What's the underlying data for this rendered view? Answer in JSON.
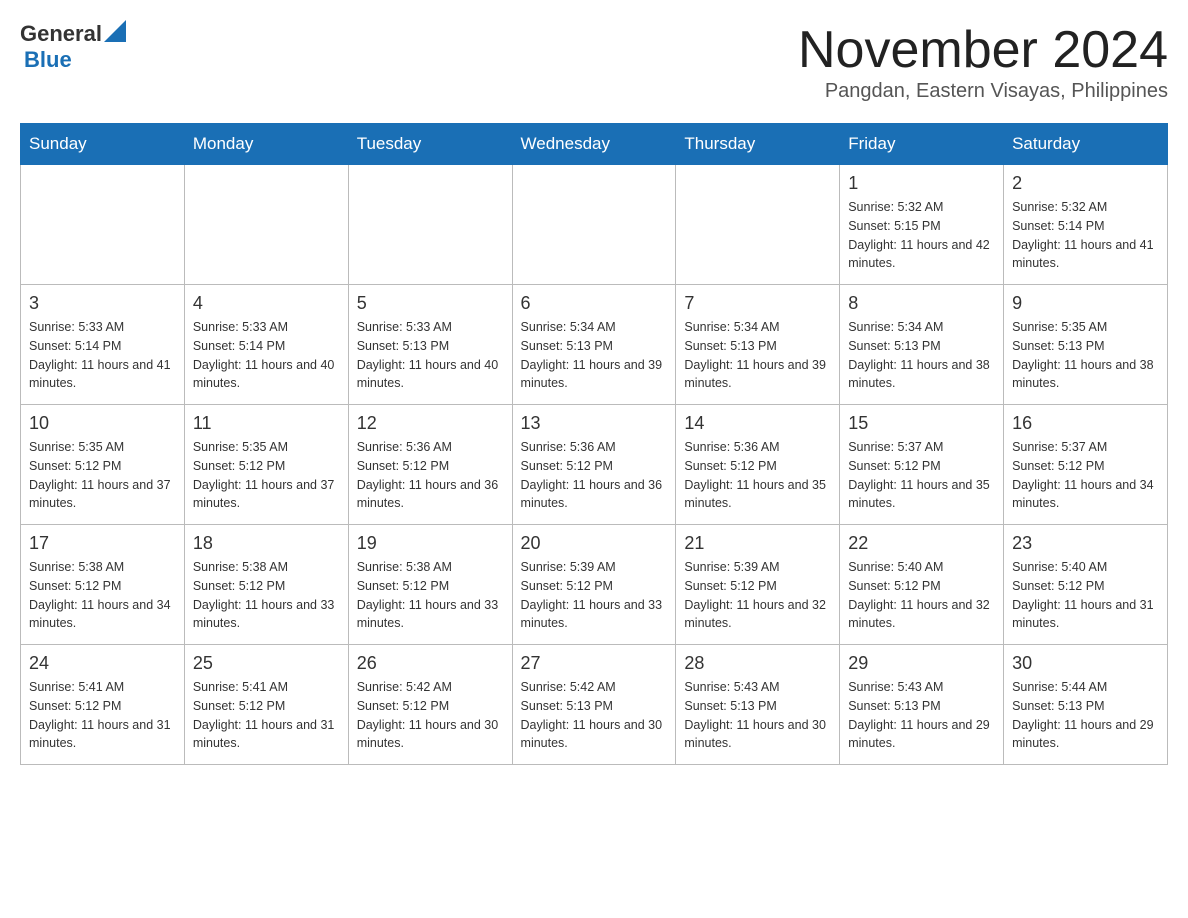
{
  "header": {
    "logo_general": "General",
    "logo_blue": "Blue",
    "month_title": "November 2024",
    "location": "Pangdan, Eastern Visayas, Philippines"
  },
  "weekdays": [
    "Sunday",
    "Monday",
    "Tuesday",
    "Wednesday",
    "Thursday",
    "Friday",
    "Saturday"
  ],
  "weeks": [
    [
      {
        "day": "",
        "info": ""
      },
      {
        "day": "",
        "info": ""
      },
      {
        "day": "",
        "info": ""
      },
      {
        "day": "",
        "info": ""
      },
      {
        "day": "",
        "info": ""
      },
      {
        "day": "1",
        "info": "Sunrise: 5:32 AM\nSunset: 5:15 PM\nDaylight: 11 hours and 42 minutes."
      },
      {
        "day": "2",
        "info": "Sunrise: 5:32 AM\nSunset: 5:14 PM\nDaylight: 11 hours and 41 minutes."
      }
    ],
    [
      {
        "day": "3",
        "info": "Sunrise: 5:33 AM\nSunset: 5:14 PM\nDaylight: 11 hours and 41 minutes."
      },
      {
        "day": "4",
        "info": "Sunrise: 5:33 AM\nSunset: 5:14 PM\nDaylight: 11 hours and 40 minutes."
      },
      {
        "day": "5",
        "info": "Sunrise: 5:33 AM\nSunset: 5:13 PM\nDaylight: 11 hours and 40 minutes."
      },
      {
        "day": "6",
        "info": "Sunrise: 5:34 AM\nSunset: 5:13 PM\nDaylight: 11 hours and 39 minutes."
      },
      {
        "day": "7",
        "info": "Sunrise: 5:34 AM\nSunset: 5:13 PM\nDaylight: 11 hours and 39 minutes."
      },
      {
        "day": "8",
        "info": "Sunrise: 5:34 AM\nSunset: 5:13 PM\nDaylight: 11 hours and 38 minutes."
      },
      {
        "day": "9",
        "info": "Sunrise: 5:35 AM\nSunset: 5:13 PM\nDaylight: 11 hours and 38 minutes."
      }
    ],
    [
      {
        "day": "10",
        "info": "Sunrise: 5:35 AM\nSunset: 5:12 PM\nDaylight: 11 hours and 37 minutes."
      },
      {
        "day": "11",
        "info": "Sunrise: 5:35 AM\nSunset: 5:12 PM\nDaylight: 11 hours and 37 minutes."
      },
      {
        "day": "12",
        "info": "Sunrise: 5:36 AM\nSunset: 5:12 PM\nDaylight: 11 hours and 36 minutes."
      },
      {
        "day": "13",
        "info": "Sunrise: 5:36 AM\nSunset: 5:12 PM\nDaylight: 11 hours and 36 minutes."
      },
      {
        "day": "14",
        "info": "Sunrise: 5:36 AM\nSunset: 5:12 PM\nDaylight: 11 hours and 35 minutes."
      },
      {
        "day": "15",
        "info": "Sunrise: 5:37 AM\nSunset: 5:12 PM\nDaylight: 11 hours and 35 minutes."
      },
      {
        "day": "16",
        "info": "Sunrise: 5:37 AM\nSunset: 5:12 PM\nDaylight: 11 hours and 34 minutes."
      }
    ],
    [
      {
        "day": "17",
        "info": "Sunrise: 5:38 AM\nSunset: 5:12 PM\nDaylight: 11 hours and 34 minutes."
      },
      {
        "day": "18",
        "info": "Sunrise: 5:38 AM\nSunset: 5:12 PM\nDaylight: 11 hours and 33 minutes."
      },
      {
        "day": "19",
        "info": "Sunrise: 5:38 AM\nSunset: 5:12 PM\nDaylight: 11 hours and 33 minutes."
      },
      {
        "day": "20",
        "info": "Sunrise: 5:39 AM\nSunset: 5:12 PM\nDaylight: 11 hours and 33 minutes."
      },
      {
        "day": "21",
        "info": "Sunrise: 5:39 AM\nSunset: 5:12 PM\nDaylight: 11 hours and 32 minutes."
      },
      {
        "day": "22",
        "info": "Sunrise: 5:40 AM\nSunset: 5:12 PM\nDaylight: 11 hours and 32 minutes."
      },
      {
        "day": "23",
        "info": "Sunrise: 5:40 AM\nSunset: 5:12 PM\nDaylight: 11 hours and 31 minutes."
      }
    ],
    [
      {
        "day": "24",
        "info": "Sunrise: 5:41 AM\nSunset: 5:12 PM\nDaylight: 11 hours and 31 minutes."
      },
      {
        "day": "25",
        "info": "Sunrise: 5:41 AM\nSunset: 5:12 PM\nDaylight: 11 hours and 31 minutes."
      },
      {
        "day": "26",
        "info": "Sunrise: 5:42 AM\nSunset: 5:12 PM\nDaylight: 11 hours and 30 minutes."
      },
      {
        "day": "27",
        "info": "Sunrise: 5:42 AM\nSunset: 5:13 PM\nDaylight: 11 hours and 30 minutes."
      },
      {
        "day": "28",
        "info": "Sunrise: 5:43 AM\nSunset: 5:13 PM\nDaylight: 11 hours and 30 minutes."
      },
      {
        "day": "29",
        "info": "Sunrise: 5:43 AM\nSunset: 5:13 PM\nDaylight: 11 hours and 29 minutes."
      },
      {
        "day": "30",
        "info": "Sunrise: 5:44 AM\nSunset: 5:13 PM\nDaylight: 11 hours and 29 minutes."
      }
    ]
  ]
}
